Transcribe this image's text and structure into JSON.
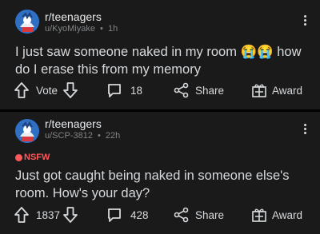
{
  "posts": [
    {
      "subreddit": "r/teenagers",
      "author": "u/KyoMiyake",
      "age": "1h",
      "nsfw": "",
      "title": "I just saw someone naked in my room 😭😭 how do I erase this from my memory",
      "vote_label": "Vote",
      "comments": "18",
      "share_label": "Share",
      "award_label": "Award"
    },
    {
      "subreddit": "r/teenagers",
      "author": "u/SCP-3812",
      "age": "22h",
      "nsfw": "NSFW",
      "title": "Just got caught being naked in someone else's room. How's your day?",
      "vote_label": "1837",
      "comments": "428",
      "share_label": "Share",
      "award_label": "Award"
    }
  ],
  "meta_separator": "•",
  "colors": {
    "background": "#000000",
    "card": "#1a1a1b",
    "text": "#d7dadc",
    "meta": "#818384",
    "nsfw": "#ff585b"
  },
  "icons": [
    "subreddit-avatar-icon",
    "more-options-icon",
    "upvote-icon",
    "downvote-icon",
    "comment-icon",
    "share-icon",
    "award-icon",
    "nsfw-icon"
  ]
}
